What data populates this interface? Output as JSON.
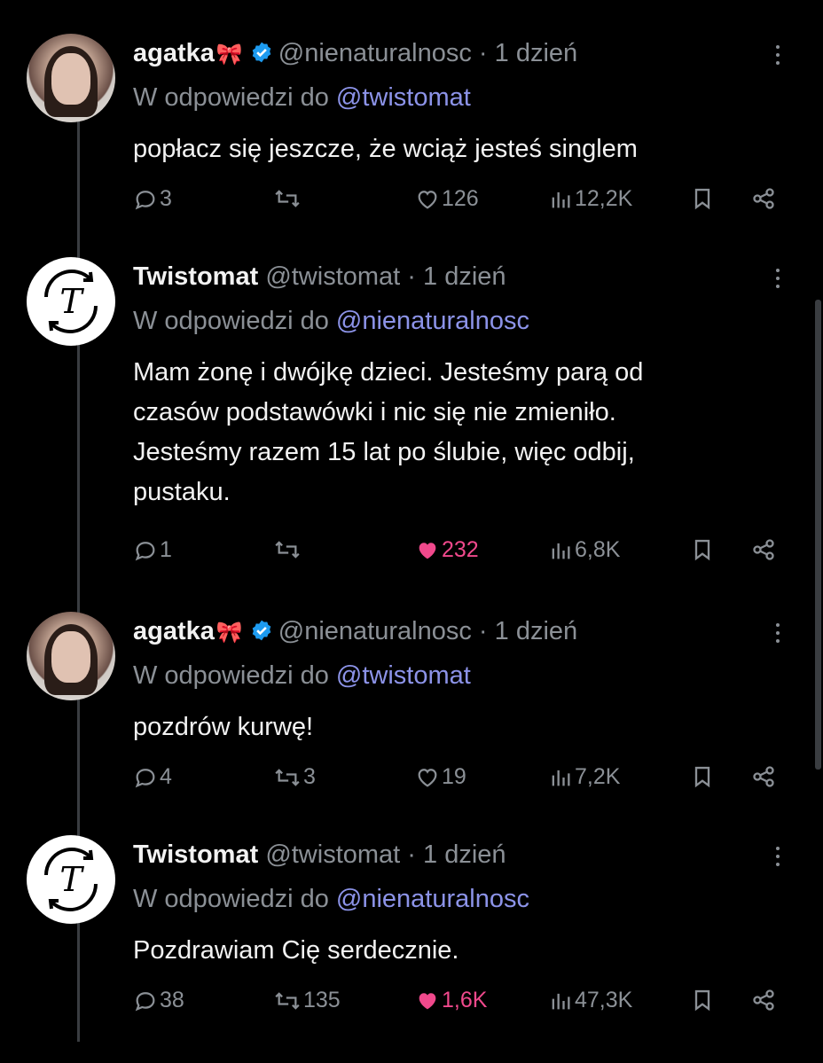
{
  "reply_prefix": "W odpowiedzi do",
  "colors": {
    "like_active": "#f0498c",
    "mention": "#8c93e8",
    "verified": "#1d9bf0",
    "muted": "#8b9096"
  },
  "tweets": [
    {
      "name": "agatka",
      "name_emoji": "🎀",
      "verified": true,
      "handle": "@nienaturalnosc",
      "time": "1 dzień",
      "reply_to": "@twistomat",
      "text": "popłacz się jeszcze, że wciąż jesteś singlem",
      "avatar_icon": "profile-photo",
      "replies": "3",
      "retweets": "",
      "likes": "126",
      "views": "12,2K",
      "liked": false
    },
    {
      "name": "Twistomat",
      "verified": false,
      "handle": "@twistomat",
      "time": "1 dzień",
      "reply_to": "@nienaturalnosc",
      "text_lines": [
        "Mam żonę i dwójkę dzieci. Jesteśmy parą od",
        "czasów podstawówki i nic się nie zmieniło.",
        "Jesteśmy razem 15 lat po ślubie, więc odbij,",
        "pustaku."
      ],
      "avatar_icon": "twistomat-logo",
      "replies": "1",
      "retweets": "",
      "likes": "232",
      "views": "6,8K",
      "liked": true
    },
    {
      "name": "agatka",
      "name_emoji": "🎀",
      "verified": true,
      "handle": "@nienaturalnosc",
      "time": "1 dzień",
      "reply_to": "@twistomat",
      "text": "pozdrów kurwę!",
      "avatar_icon": "profile-photo",
      "replies": "4",
      "retweets": "3",
      "likes": "19",
      "views": "7,2K",
      "liked": false
    },
    {
      "name": "Twistomat",
      "verified": false,
      "handle": "@twistomat",
      "time": "1 dzień",
      "reply_to": "@nienaturalnosc",
      "text": "Pozdrawiam Cię serdecznie.",
      "avatar_icon": "twistomat-logo",
      "replies": "38",
      "retweets": "135",
      "likes": "1,6K",
      "views": "47,3K",
      "liked": true
    }
  ]
}
